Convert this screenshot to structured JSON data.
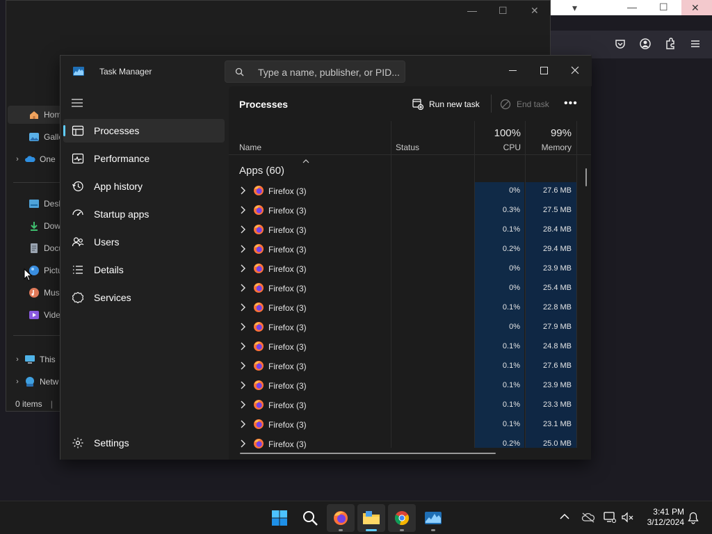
{
  "browser": {
    "window_controls": {
      "minimize": "—",
      "maximize": "☐",
      "close": "✕"
    }
  },
  "explorer": {
    "window_controls": {
      "minimize": "—",
      "maximize": "☐",
      "close": "✕"
    },
    "nav": [
      {
        "label": "Hom",
        "icon": "home-icon",
        "color": "#f0a35e"
      },
      {
        "label": "Galle",
        "icon": "gallery-icon",
        "color": "#5ab0e8"
      },
      {
        "label": "One",
        "icon": "onedrive-icon",
        "color": "#2f8fe0",
        "chevron": true
      },
      {
        "label": "Desk",
        "icon": "desktop-icon",
        "color": "#4fa3d9"
      },
      {
        "label": "Dow",
        "icon": "downloads-icon",
        "color": "#3fbf6f"
      },
      {
        "label": "Docu",
        "icon": "documents-icon",
        "color": "#9aa4b1"
      },
      {
        "label": "Pictu",
        "icon": "pictures-icon",
        "color": "#3a8ee0"
      },
      {
        "label": "Musi",
        "icon": "music-icon",
        "color": "#e07a5a"
      },
      {
        "label": "Vide",
        "icon": "videos-icon",
        "color": "#8a5ae0"
      },
      {
        "label": "This",
        "icon": "this-pc-icon",
        "color": "#4fb3e8",
        "chevron": true
      },
      {
        "label": "Netw",
        "icon": "network-icon",
        "color": "#3fa0e0",
        "chevron": true
      }
    ],
    "status": "0 items"
  },
  "taskmanager": {
    "title": "Task Manager",
    "search_placeholder": "Type a name, publisher, or PID...",
    "window_controls": {
      "minimize": "—",
      "maximize": "☐",
      "close": "✕"
    },
    "nav": [
      {
        "label": "Processes",
        "icon": "processes-icon",
        "selected": true
      },
      {
        "label": "Performance",
        "icon": "performance-icon"
      },
      {
        "label": "App history",
        "icon": "app-history-icon"
      },
      {
        "label": "Startup apps",
        "icon": "startup-apps-icon"
      },
      {
        "label": "Users",
        "icon": "users-icon"
      },
      {
        "label": "Details",
        "icon": "details-icon"
      },
      {
        "label": "Services",
        "icon": "services-icon"
      }
    ],
    "settings_label": "Settings",
    "page_title": "Processes",
    "run_new_task": "Run new task",
    "end_task": "End task",
    "more": "•••",
    "columns": {
      "name": "Name",
      "status": "Status",
      "cpu_total": "100%",
      "cpu": "CPU",
      "memory_total": "99%",
      "memory": "Memory"
    },
    "group_label": "Apps (60)",
    "rows": [
      {
        "name": "Firefox (3)",
        "cpu": "0%",
        "memory": "27.6 MB"
      },
      {
        "name": "Firefox (3)",
        "cpu": "0.3%",
        "memory": "27.5 MB"
      },
      {
        "name": "Firefox (3)",
        "cpu": "0.1%",
        "memory": "28.4 MB"
      },
      {
        "name": "Firefox (3)",
        "cpu": "0.2%",
        "memory": "29.4 MB"
      },
      {
        "name": "Firefox (3)",
        "cpu": "0%",
        "memory": "23.9 MB"
      },
      {
        "name": "Firefox (3)",
        "cpu": "0%",
        "memory": "25.4 MB"
      },
      {
        "name": "Firefox (3)",
        "cpu": "0.1%",
        "memory": "22.8 MB"
      },
      {
        "name": "Firefox (3)",
        "cpu": "0%",
        "memory": "27.9 MB"
      },
      {
        "name": "Firefox (3)",
        "cpu": "0.1%",
        "memory": "24.8 MB"
      },
      {
        "name": "Firefox (3)",
        "cpu": "0.1%",
        "memory": "27.6 MB"
      },
      {
        "name": "Firefox (3)",
        "cpu": "0.1%",
        "memory": "23.9 MB"
      },
      {
        "name": "Firefox (3)",
        "cpu": "0.1%",
        "memory": "23.3 MB"
      },
      {
        "name": "Firefox (3)",
        "cpu": "0.1%",
        "memory": "23.1 MB"
      },
      {
        "name": "Firefox (3)",
        "cpu": "0.2%",
        "memory": "25.0 MB"
      }
    ]
  },
  "taskbar": {
    "apps": [
      "start-button",
      "search-button",
      "firefox-app",
      "file-explorer-app",
      "chrome-app",
      "task-manager-app"
    ],
    "clock_time": "3:41 PM",
    "clock_date": "3/12/2024"
  },
  "colors": {
    "accent": "#60cdff",
    "cpu_column": "#102a47",
    "memory_column": "#0f2744",
    "background": "#202020"
  }
}
